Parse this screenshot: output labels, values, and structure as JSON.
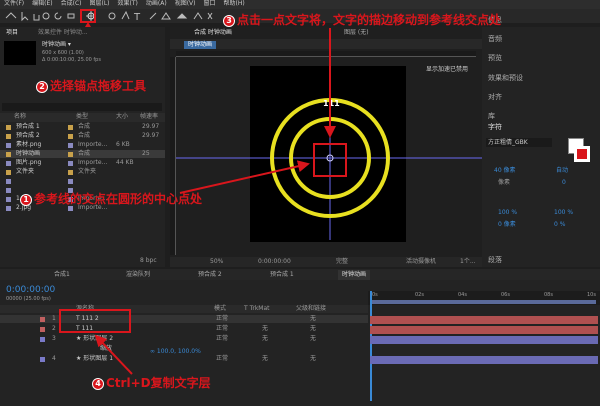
{
  "menu": [
    "文件(F)",
    "编辑(E)",
    "合成(C)",
    "图层(L)",
    "效果(T)",
    "动画(A)",
    "视图(V)",
    "窗口",
    "帮助(H)"
  ],
  "project": {
    "tabs": [
      "项目",
      "效果控件 时钟动..."
    ],
    "comp_name": "时钟动画 ▾",
    "comp_info": [
      "600 x 600 (1.00)",
      "Δ 0:00:10:00, 25.00 fps"
    ],
    "columns": [
      "名称",
      "类型",
      "大小",
      "帧速率"
    ],
    "items": [
      {
        "name": "预合成 1",
        "type": "合成",
        "size": "",
        "fps": "29.97",
        "color": "#c8a14b"
      },
      {
        "name": "预合成 2",
        "type": "合成",
        "size": "",
        "fps": "29.97",
        "color": "#c8a14b"
      },
      {
        "name": "素材.png",
        "type": "Importe...",
        "size": "6 KB",
        "fps": "",
        "color": "#8a8ac0"
      },
      {
        "name": "时钟动画",
        "type": "合成",
        "size": "",
        "fps": "25",
        "color": "#c8a14b"
      },
      {
        "name": "图片.png",
        "type": "Importe...",
        "size": "44 KB",
        "fps": "",
        "color": "#8a8ac0"
      },
      {
        "name": "文件夹",
        "type": "文件夹",
        "size": "",
        "fps": "",
        "color": "#c8a14b"
      },
      {
        "name": "",
        "type": "",
        "size": "",
        "fps": "",
        "color": "#8a8ac0"
      },
      {
        "name": "",
        "type": "",
        "size": "",
        "fps": "",
        "color": "#8a8ac0"
      },
      {
        "name": "1.jpg",
        "type": "Importe...",
        "size": "",
        "fps": "",
        "color": "#8a8ac0"
      },
      {
        "name": "2.jpg",
        "type": "Importe...",
        "size": "",
        "fps": "",
        "color": "#8a8ac0"
      }
    ],
    "bpc": "8 bpc"
  },
  "composition": {
    "tabs": [
      "合成 时钟动画",
      "图层 (无)"
    ],
    "sub_tab": "时钟动画",
    "overlay": "显示加速已禁用",
    "zoom": "50%",
    "timecode": "0:00:00:00",
    "quality": "完整",
    "camera": "活动摄像机",
    "views": "1个..."
  },
  "right_panel": {
    "items": [
      "信息",
      "音频",
      "预览",
      "效果和预设",
      "对齐",
      "库",
      "字符",
      "段落"
    ],
    "font": "方正粗倩_GBK",
    "size": "40 像素",
    "leading": "自动",
    "tracking": "0",
    "px": "像素",
    "scale_v": "100 %",
    "scale_h": "100 %",
    "baseline": "0 像素",
    "tsume": "0 %"
  },
  "timeline": {
    "tabs": [
      "合成1",
      "渲染队列",
      "预合成 2",
      "预合成 1",
      "时钟动画"
    ],
    "timecode": "0:00:00:00",
    "fps_info": "00000 (25.00 fps)",
    "columns": [
      "源名称",
      "模式",
      "T TrkMat",
      "父级和链接"
    ],
    "layers": [
      {
        "num": "1",
        "name": "T 111 2",
        "mode": "正常",
        "trk": "",
        "parent": "无",
        "color": "#c06060"
      },
      {
        "num": "2",
        "name": "T 111",
        "mode": "正常",
        "trk": "无",
        "parent": "无",
        "color": "#c06060"
      },
      {
        "num": "3",
        "name": "★ 形状图层 2",
        "mode": "正常",
        "trk": "无",
        "parent": "无",
        "color": "#7a7ac8"
      },
      {
        "num": "",
        "name": "缩放",
        "mode": "",
        "trk": "",
        "parent": "",
        "color": ""
      },
      {
        "num": "4",
        "name": "★ 形状图层 1",
        "mode": "正常",
        "trk": "无",
        "parent": "无",
        "color": "#7a7ac8"
      }
    ],
    "scale_value": "∞ 100.0, 100.0%",
    "ruler": [
      "0s",
      "02s",
      "04s",
      "06s",
      "08s",
      "10s"
    ],
    "bar_colors": [
      "#b05050",
      "#b05050",
      "#6a6ab4",
      "#6a6ab4",
      "#6a6ab4"
    ]
  },
  "annotations": {
    "a1": {
      "num": "1",
      "text": "参考线的交点在圆形的中心点处"
    },
    "a2": {
      "num": "2",
      "text": "选择锚点拖移工具"
    },
    "a3": {
      "num": "3",
      "text": "点击一点文字将，文字的描边移动到参考线交点处"
    },
    "a4": {
      "num": "4",
      "text": "Ctrl+D复制文字层"
    }
  },
  "canvas_label": "111",
  "colors": {
    "ring": "#e8e020",
    "guide": "#6a6af0",
    "accent_red": "#d9161c",
    "timeline_blue": "#3a8ad6"
  }
}
